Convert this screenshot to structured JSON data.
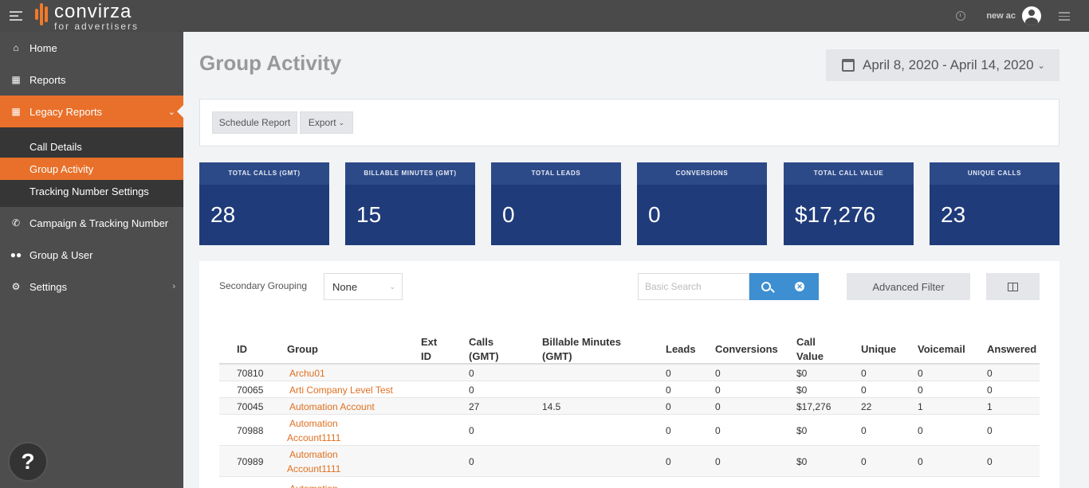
{
  "brand": {
    "name": "convirza",
    "sub": "for advertisers"
  },
  "header": {
    "user": "new ac"
  },
  "sidebar": {
    "items": [
      {
        "label": "Home",
        "icon": "home-icon"
      },
      {
        "label": "Reports",
        "icon": "bar-chart-icon"
      },
      {
        "label": "Legacy Reports",
        "icon": "bar-chart-icon"
      },
      {
        "label": "Campaign & Tracking Number",
        "icon": "phone-icon"
      },
      {
        "label": "Group & User",
        "icon": "users-icon"
      },
      {
        "label": "Settings",
        "icon": "gear-icon"
      }
    ],
    "legacy_sub": [
      "Call Details",
      "Group Activity",
      "Tracking Number Settings"
    ],
    "help": "?"
  },
  "page": {
    "title": "Group Activity",
    "date_range": "April 8, 2020 - April 14, 2020"
  },
  "toolbar": {
    "schedule": "Schedule Report",
    "export": "Export"
  },
  "cards": [
    {
      "label": "TOTAL CALLS (GMT)",
      "value": "28"
    },
    {
      "label": "BILLABLE MINUTES (GMT)",
      "value": "15"
    },
    {
      "label": "TOTAL LEADS",
      "value": "0"
    },
    {
      "label": "CONVERSIONS",
      "value": "0"
    },
    {
      "label": "TOTAL CALL VALUE",
      "value": "$17,276"
    },
    {
      "label": "UNIQUE CALLS",
      "value": "23"
    }
  ],
  "filters": {
    "secondary_label": "Secondary Grouping",
    "secondary_value": "None",
    "search_placeholder": "Basic Search",
    "advanced": "Advanced Filter"
  },
  "table": {
    "headers": {
      "id": "ID",
      "group": "Group",
      "ext1": "Ext",
      "ext2": "ID",
      "calls1": "Calls",
      "calls2": "(GMT)",
      "bill1": "Billable Minutes",
      "bill2": "(GMT)",
      "leads": "Leads",
      "conversions": "Conversions",
      "value1": "Call",
      "value2": "Value",
      "unique": "Unique",
      "voicemail": "Voicemail",
      "answered": "Answered"
    },
    "rows": [
      {
        "id": "70810",
        "g1": "Archu01",
        "g2": "",
        "calls": "0",
        "bill": "",
        "leads": "0",
        "conv": "0",
        "value": "$0",
        "unique": "0",
        "vm": "0",
        "ans": "0"
      },
      {
        "id": "70065",
        "g1": "Arti Company Level Test",
        "g2": "",
        "calls": "0",
        "bill": "",
        "leads": "0",
        "conv": "0",
        "value": "$0",
        "unique": "0",
        "vm": "0",
        "ans": "0"
      },
      {
        "id": "70045",
        "g1": "Automation Account",
        "g2": "",
        "calls": "27",
        "bill": "14.5",
        "leads": "0",
        "conv": "0",
        "value": "$17,276",
        "unique": "22",
        "vm": "1",
        "ans": "1"
      },
      {
        "id": "70988",
        "g1": "Automation",
        "g2": "Account1111",
        "calls": "0",
        "bill": "",
        "leads": "0",
        "conv": "0",
        "value": "$0",
        "unique": "0",
        "vm": "0",
        "ans": "0"
      },
      {
        "id": "70989",
        "g1": "Automation",
        "g2": "Account1111",
        "calls": "0",
        "bill": "",
        "leads": "0",
        "conv": "0",
        "value": "$0",
        "unique": "0",
        "vm": "0",
        "ans": "0"
      },
      {
        "id": "",
        "g1": "Automation",
        "g2": "",
        "calls": "",
        "bill": "",
        "leads": "",
        "conv": "",
        "value": "",
        "unique": "",
        "vm": "",
        "ans": ""
      }
    ]
  }
}
